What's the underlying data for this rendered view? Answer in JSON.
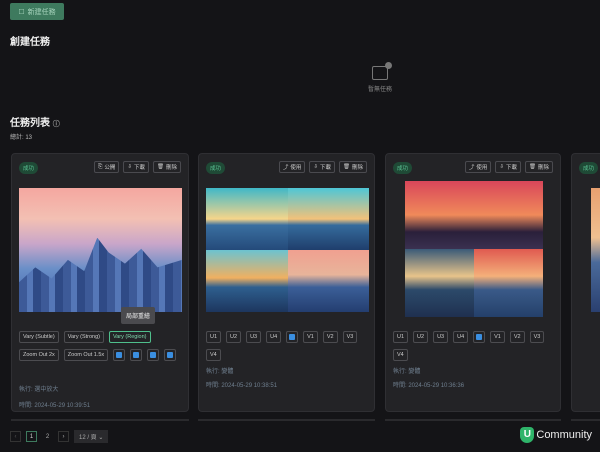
{
  "header": {
    "new_task": "新建任務"
  },
  "create": {
    "title": "創建任務",
    "empty": "暫無任務"
  },
  "list": {
    "title": "任務列表",
    "total": "總計: 13"
  },
  "cards": [
    {
      "status": "成功",
      "actions": [
        "公開",
        "下載",
        "刪除"
      ],
      "buttons": [
        "Vary (Subtle)",
        "Vary (Strong)",
        "Vary (Region)",
        "Zoom Out 2x",
        "Zoom Out 1.5x"
      ],
      "exec_label": "執行:",
      "exec": "選中放大",
      "time_label": "時間:",
      "time": "2024-05-29 10:39:51",
      "tooltip": "局部重繪"
    },
    {
      "status": "成功",
      "actions": [
        "使用",
        "下載",
        "刪除"
      ],
      "buttons": [
        "U1",
        "U2",
        "U3",
        "U4",
        "V1",
        "V2",
        "V3",
        "V4"
      ],
      "exec_label": "執行:",
      "exec": "變體",
      "time_label": "時間:",
      "time": "2024-05-29 10:38:51"
    },
    {
      "status": "成功",
      "actions": [
        "使用",
        "下載",
        "刪除"
      ],
      "buttons": [
        "U1",
        "U2",
        "U3",
        "U4",
        "V1",
        "V2",
        "V3",
        "V4"
      ],
      "exec_label": "執行:",
      "exec": "變體",
      "time_label": "時間:",
      "time": "2024-05-29 10:36:36"
    },
    {
      "status": "成功"
    }
  ],
  "pagination": {
    "prev": "‹",
    "pages": [
      "1",
      "2"
    ],
    "next": "›",
    "size": "12 / 頁"
  },
  "brand": {
    "logo_letter": "U",
    "name": "Community"
  }
}
